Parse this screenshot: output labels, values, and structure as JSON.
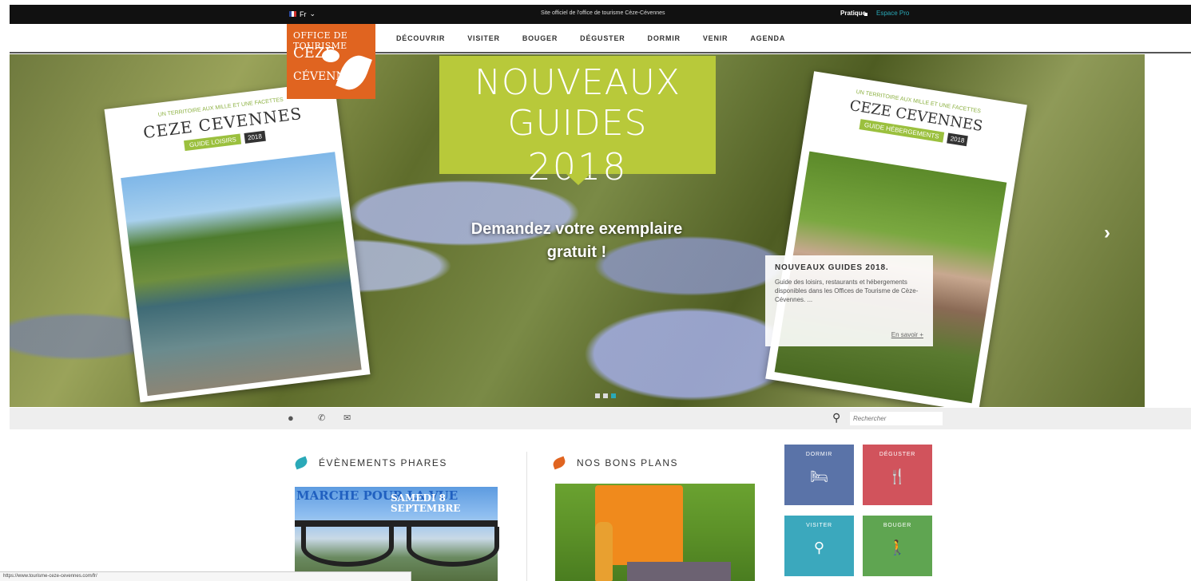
{
  "topbar": {
    "lang": "Fr",
    "center_text": "Site officiel de l'office de tourisme Cèze-Cévennes",
    "pratique": "Pratique",
    "espace_pro": "Espace Pro"
  },
  "logo": {
    "line1": "OFFICE DE TOURISME",
    "line2": "CÈZE",
    "line3": "CÉVENNES"
  },
  "nav": {
    "items": [
      "DÉCOUVRIR",
      "VISITER",
      "BOUGER",
      "DÉGUSTER",
      "DORMIR",
      "VENIR",
      "AGENDA"
    ]
  },
  "hero": {
    "title_line1": "NOUVEAUX GUIDES",
    "title_line2": "2018",
    "subtitle_line1": "Demandez votre exemplaire",
    "subtitle_line2": "gratuit !",
    "guide_left": {
      "small": "UN TERRITOIRE AUX MILLE ET UNE FACETTES",
      "title": "CEZE CEVENNES",
      "tag": "GUIDE LOISIRS",
      "year": "2018"
    },
    "guide_right": {
      "small": "UN TERRITOIRE AUX MILLE ET UNE FACETTES",
      "title": "CEZE CEVENNES",
      "tag": "GUIDE HÉBERGEMENTS",
      "year": "2018"
    },
    "caption": {
      "title": "NOUVEAUX GUIDES 2018.",
      "desc": "Guide des loisirs, restaurants et hébergements disponibles dans les Offices de Tourisme de Cèze-Cévennes. ...",
      "more": "En savoir +"
    },
    "arrow": "›",
    "slides_count": 3,
    "active_slide": 3
  },
  "subbar": {
    "search_placeholder": "Rechercher"
  },
  "sections": {
    "events_title": "ÉVÈNEMENTS PHARES",
    "events_card_text": "MARCHE POUR LA VUE",
    "events_card_date": "SAMEDI 8 SEPTEMBRE",
    "deals_title": "NOS BONS PLANS"
  },
  "tiles": [
    {
      "label": "DORMIR",
      "icon": "bed-icon",
      "color": "#5a73a8"
    },
    {
      "label": "DÉGUSTER",
      "icon": "cutlery-icon",
      "color": "#d1535c"
    },
    {
      "label": "VISITER",
      "icon": "map-pin-icon",
      "color": "#3ba8bd"
    },
    {
      "label": "BOUGER",
      "icon": "hiker-icon",
      "color": "#5fa551"
    }
  ],
  "colors": {
    "brand_orange": "#e06420",
    "accent_teal": "#2aa9b8",
    "hero_green": "#b8c93a"
  },
  "status_url": "https://www.tourisme-ceze-cevennes.com/fr/"
}
